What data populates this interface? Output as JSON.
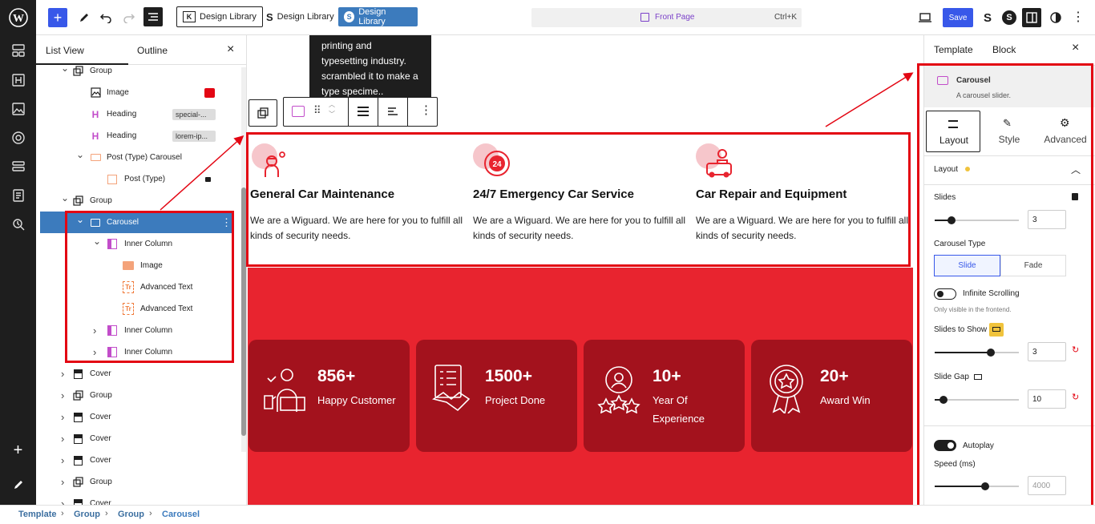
{
  "topbar": {
    "design_library_1": "Design Library",
    "design_library_2": "Design Library",
    "design_library_3": "Design Library",
    "page_name": "Front Page",
    "shortcut": "Ctrl+K",
    "save_label": "Save"
  },
  "list_view": {
    "tab_list": "List View",
    "tab_outline": "Outline",
    "rows": [
      {
        "label": "Group"
      },
      {
        "label": "Image"
      },
      {
        "label": "Heading",
        "chip": "special-..."
      },
      {
        "label": "Heading",
        "chip": "lorem-ip..."
      },
      {
        "label": "Post (Type) Carousel"
      },
      {
        "label": "Post (Type)"
      },
      {
        "label": "Group"
      },
      {
        "label": "Carousel"
      },
      {
        "label": "Inner Column"
      },
      {
        "label": "Image"
      },
      {
        "label": "Advanced Text"
      },
      {
        "label": "Advanced Text"
      },
      {
        "label": "Inner Column"
      },
      {
        "label": "Inner Column"
      },
      {
        "label": "Cover"
      },
      {
        "label": "Group"
      },
      {
        "label": "Cover"
      },
      {
        "label": "Cover"
      },
      {
        "label": "Cover"
      },
      {
        "label": "Group"
      },
      {
        "label": "Cover"
      }
    ]
  },
  "canvas": {
    "top_text": [
      "printing and",
      "typesetting industry.",
      "scrambled it to make a",
      "type specime.."
    ],
    "services": [
      {
        "title": "General Car Maintenance",
        "text": "We are a Wiguard. We are here for you to fulfill all kinds of security needs."
      },
      {
        "title": "24/7 Emergency Car Service",
        "text": "We are a Wiguard. We are here for you to fulfill all kinds of security needs."
      },
      {
        "title": "Car Repair and Equipment",
        "text": "We are a Wiguard. We are here for you to fulfill all kinds of security needs."
      }
    ],
    "stats": [
      {
        "number": "856+",
        "label": "Happy Customer"
      },
      {
        "number": "1500+",
        "label": "Project Done"
      },
      {
        "number": "10+",
        "label": "Year Of Experience"
      },
      {
        "number": "20+",
        "label": "Award Win"
      }
    ],
    "badge_24": "24"
  },
  "settings": {
    "tab_template": "Template",
    "tab_block": "Block",
    "block_name": "Carousel",
    "block_desc": "A carousel slider.",
    "subtabs": [
      "Layout",
      "Style",
      "Advanced"
    ],
    "section_layout": "Layout",
    "slides_label": "Slides",
    "slides_value": "3",
    "slides_fraction": 0.2,
    "carousel_type_label": "Carousel Type",
    "carousel_type_options": [
      "Slide",
      "Fade"
    ],
    "carousel_type_selected": "Slide",
    "infinite_label": "Infinite Scrolling",
    "infinite_on": false,
    "infinite_help": "Only visible in the frontend.",
    "slides_show_label": "Slides to Show",
    "slides_show_value": "3",
    "slides_show_fraction": 0.67,
    "slide_gap_label": "Slide Gap",
    "slide_gap_value": "10",
    "slide_gap_fraction": 0.1,
    "autoplay_label": "Autoplay",
    "autoplay_on": true,
    "speed_label": "Speed (ms)",
    "speed_placeholder": "4000",
    "speed_fraction": 0.6
  },
  "breadcrumb": [
    "Template",
    "Group",
    "Group",
    "Carousel"
  ],
  "colors": {
    "accent": "#3858e9",
    "highlight": "#e30613",
    "brand_red": "#e8242f",
    "stat_bg": "#a3121d",
    "selected_row": "#3c7bbd"
  }
}
